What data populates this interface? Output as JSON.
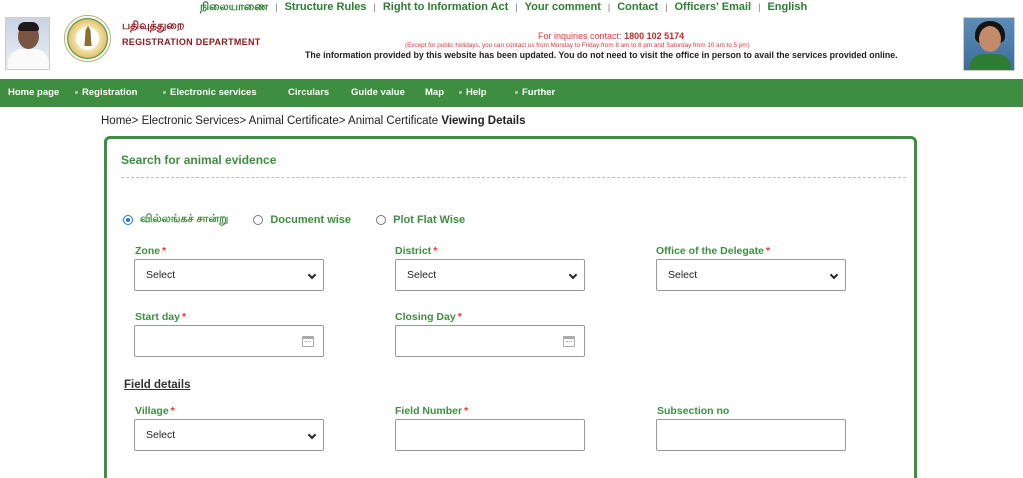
{
  "top_links": [
    "நிலையாணை",
    "Structure Rules",
    "Right to Information Act",
    "Your comment",
    "Contact",
    "Officers' Email",
    "English"
  ],
  "header": {
    "dept_tamil": "பதிவுத்துறை",
    "dept_english": "REGISTRATION DEPARTMENT",
    "inquiry_label": "For inquiries contact:",
    "inquiry_phone": "1800 102 5174",
    "hours_note": "(Except for public holidays, you can contact us from Monday to Friday from 8 am to 8 pm and Saturday from 10 am to 5 pm)",
    "info_text": "The information provided by this website has been updated. You do not need to visit the office in person to avail the services provided online."
  },
  "nav": [
    {
      "label": "Home page",
      "dot": false
    },
    {
      "label": "Registration",
      "dot": true
    },
    {
      "label": "Electronic services",
      "dot": true
    },
    {
      "label": "Circulars",
      "dot": false
    },
    {
      "label": "Guide value",
      "dot": false
    },
    {
      "label": "Map",
      "dot": false
    },
    {
      "label": "Help",
      "dot": true
    },
    {
      "label": "Further",
      "dot": true
    }
  ],
  "breadcrumb": {
    "path": "Home> Electronic Services> Animal Certificate> Animal Certificate",
    "current": "Viewing Details"
  },
  "card": {
    "title": "Search for animal evidence",
    "radios": [
      {
        "label": "வில்லங்கச் சான்று",
        "checked": true
      },
      {
        "label": "Document wise",
        "checked": false
      },
      {
        "label": "Plot Flat Wise",
        "checked": false
      }
    ],
    "fields": {
      "zone": {
        "label": "Zone",
        "value": "Select"
      },
      "district": {
        "label": "District",
        "value": "Select"
      },
      "office": {
        "label": "Office of the Delegate",
        "value": "Select"
      },
      "start_day": {
        "label": "Start day",
        "value": ""
      },
      "closing_day": {
        "label": "Closing Day",
        "value": ""
      },
      "village": {
        "label": "Village",
        "value": "Select"
      },
      "field_number": {
        "label": "Field Number",
        "value": ""
      },
      "subsection": {
        "label": "Subsection no",
        "value": ""
      }
    },
    "section_heading": "Field details",
    "required_mark": "*"
  },
  "colors": {
    "brand_green": "#3e8e41",
    "required_red": "#e53935",
    "header_red": "#8b1a1a"
  }
}
